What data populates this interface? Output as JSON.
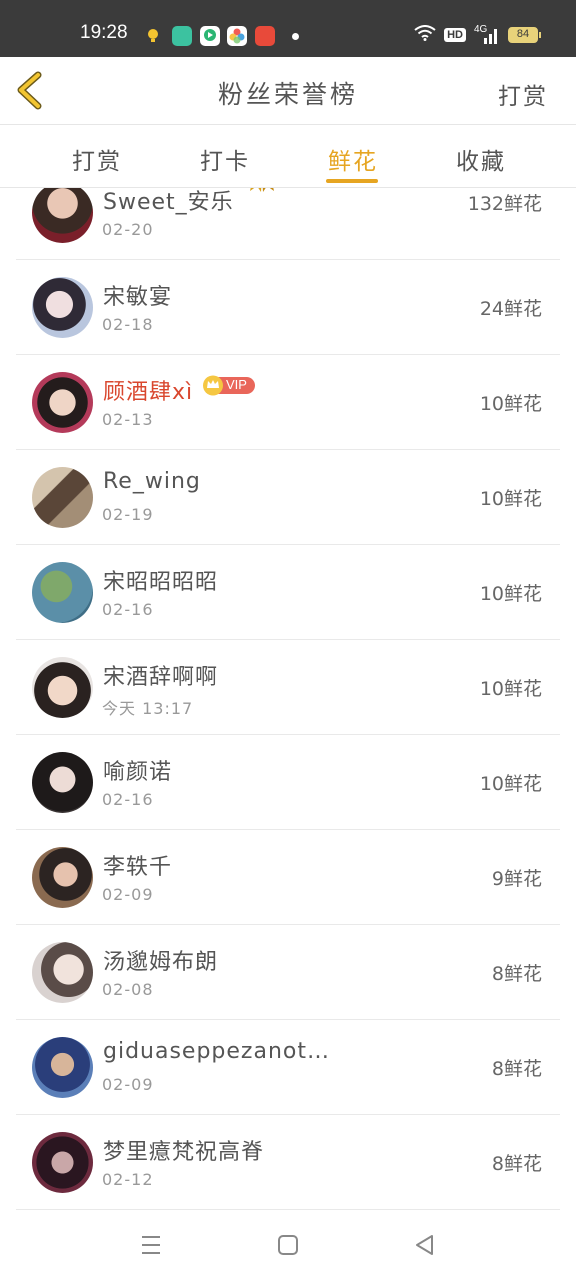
{
  "status_bar": {
    "time": "19:28",
    "network": "4G",
    "hd": "HD",
    "battery": "84"
  },
  "header": {
    "title": "粉丝荣誉榜",
    "action_label": "打赏"
  },
  "tabs": [
    {
      "label": "打赏",
      "active": false
    },
    {
      "label": "打卡",
      "active": false
    },
    {
      "label": "鲜花",
      "active": true
    },
    {
      "label": "收藏",
      "active": false
    }
  ],
  "colors": {
    "accent": "#e6a521",
    "vip_name": "#d9472e"
  },
  "rows": [
    {
      "name": "Sweet_安乐",
      "date": "02-20",
      "amount": "132鲜花",
      "badge": "medal-icon"
    },
    {
      "name": "宋敏宴",
      "date": "02-18",
      "amount": "24鲜花"
    },
    {
      "name": "顾酒肆xì",
      "date": "02-13",
      "amount": "10鲜花",
      "vip": true,
      "vip_label": "VIP"
    },
    {
      "name": "Re_wing",
      "date": "02-19",
      "amount": "10鲜花"
    },
    {
      "name": "宋昭昭昭昭",
      "date": "02-16",
      "amount": "10鲜花"
    },
    {
      "name": "宋酒辞啊啊",
      "date": "今天 13:17",
      "amount": "10鲜花"
    },
    {
      "name": "喻颜诺",
      "date": "02-16",
      "amount": "10鲜花"
    },
    {
      "name": "李轶千",
      "date": "02-09",
      "amount": "9鲜花"
    },
    {
      "name": "汤邈姆布朗",
      "date": "02-08",
      "amount": "8鲜花"
    },
    {
      "name": "giduaseppezanot…",
      "date": "02-09",
      "amount": "8鲜花"
    },
    {
      "name": "梦里癔梵祝高脊",
      "date": "02-12",
      "amount": "8鲜花"
    }
  ]
}
